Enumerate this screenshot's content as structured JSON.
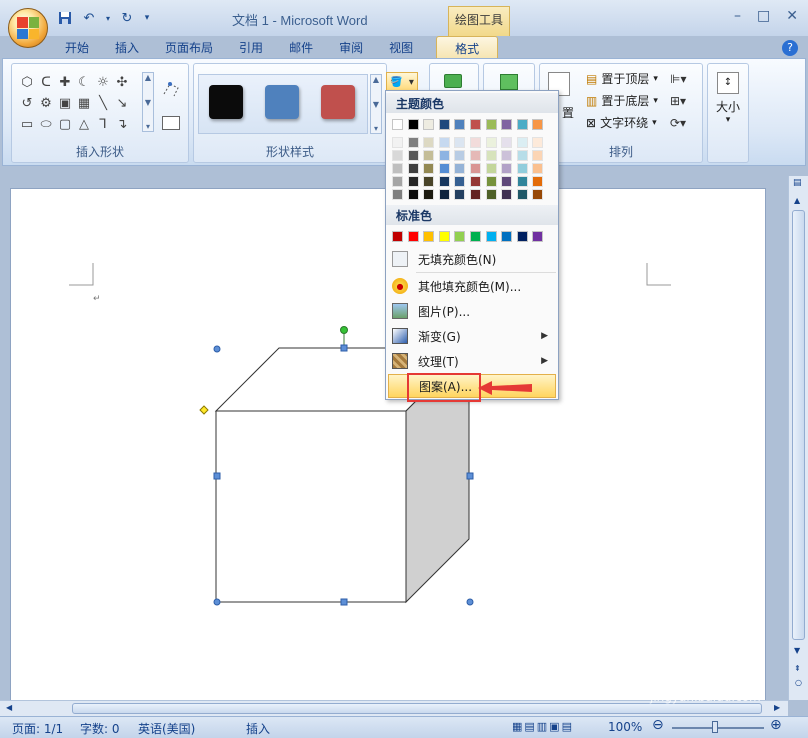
{
  "window": {
    "title": "文档 1 - Microsoft Word",
    "context_tab_header": "绘图工具",
    "controls": [
      "–",
      "□",
      "✕"
    ]
  },
  "tabs": [
    "开始",
    "插入",
    "页面布局",
    "引用",
    "邮件",
    "审阅",
    "视图",
    "格式"
  ],
  "active_tab": "格式",
  "ribbon": {
    "groups": {
      "insert_shapes": "插入形状",
      "shape_styles": "形状样式",
      "arrange": "排列"
    },
    "shape_style_swatches": [
      "#0b0b0b",
      "#4f81bd",
      "#c0504d"
    ],
    "arrange_items": [
      "置于顶层",
      "置于底层",
      "文字环绕"
    ],
    "position_partial": "置",
    "size_label": "大小"
  },
  "fill_menu": {
    "theme_colors_heading": "主题颜色",
    "theme_top_row": [
      "#ffffff",
      "#000000",
      "#eeece1",
      "#1f497d",
      "#4f81bd",
      "#c0504d",
      "#9bbb59",
      "#8064a2",
      "#4bacc6",
      "#f79646"
    ],
    "theme_shades": [
      [
        "#f2f2f2",
        "#d8d8d8",
        "#bfbfbf",
        "#a5a5a5",
        "#7f7f7f"
      ],
      [
        "#7f7f7f",
        "#595959",
        "#3f3f3f",
        "#262626",
        "#0c0c0c"
      ],
      [
        "#ddd9c3",
        "#c4bd97",
        "#938953",
        "#494429",
        "#1d1b10"
      ],
      [
        "#c6d9f0",
        "#8db3e2",
        "#548dd4",
        "#17365d",
        "#0f243e"
      ],
      [
        "#dbe5f1",
        "#b8cce4",
        "#95b3d7",
        "#366092",
        "#244061"
      ],
      [
        "#f2dcdb",
        "#e5b9b7",
        "#d99694",
        "#953734",
        "#632423"
      ],
      [
        "#ebf1dd",
        "#d7e3bc",
        "#c3d69b",
        "#76923c",
        "#4f6128"
      ],
      [
        "#e5e0ec",
        "#ccc1d9",
        "#b2a2c7",
        "#5f497a",
        "#3f3151"
      ],
      [
        "#dbeef3",
        "#b7dde8",
        "#92cddc",
        "#31859b",
        "#205867"
      ],
      [
        "#fdeada",
        "#fbd5b5",
        "#fac08f",
        "#e36c09",
        "#974806"
      ]
    ],
    "standard_colors_heading": "标准色",
    "standard_colors": [
      "#c00000",
      "#ff0000",
      "#ffc000",
      "#ffff00",
      "#92d050",
      "#00b050",
      "#00b0f0",
      "#0070c0",
      "#002060",
      "#7030a0"
    ],
    "items": {
      "no_fill": "无填充颜色(N)",
      "more_colors": "其他填充颜色(M)...",
      "picture": "图片(P)...",
      "gradient": "渐变(G)",
      "texture": "纹理(T)",
      "pattern": "图案(A)..."
    }
  },
  "statusbar": {
    "page": "页面: 1/1",
    "words": "字数: 0",
    "language": "英语(美国)",
    "mode": "插入",
    "zoom": "100%"
  },
  "watermark": {
    "brand": "Baidu 经验",
    "url": "jingyan.baidu.com"
  }
}
